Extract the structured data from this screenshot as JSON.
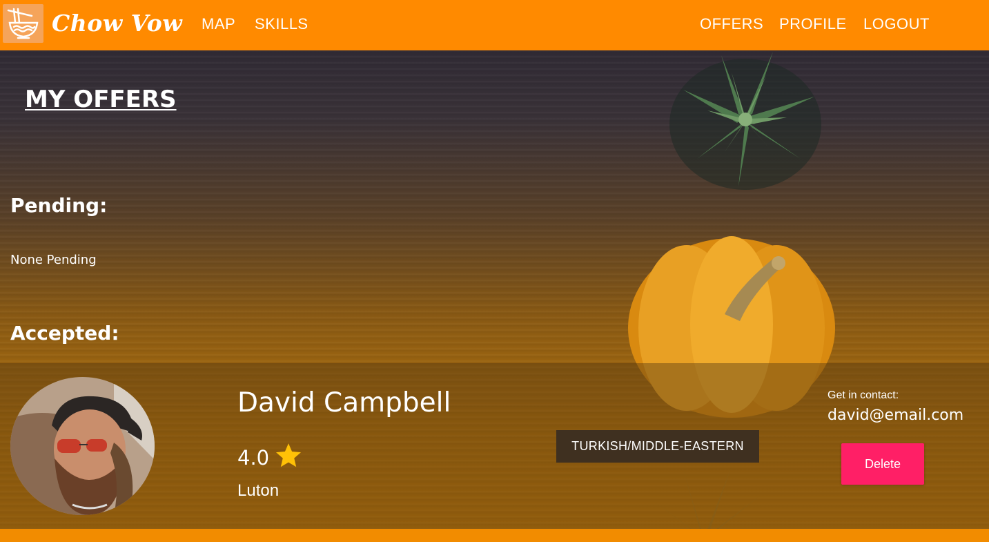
{
  "navbar": {
    "brand": "Chow Vow",
    "links_left": [
      "MAP",
      "SKILLS"
    ],
    "links_right": [
      "OFFERS",
      "PROFILE",
      "LOGOUT"
    ]
  },
  "main": {
    "title": "MY OFFERS",
    "pending_heading": "Pending:",
    "pending_empty": "None Pending",
    "accepted_heading": "Accepted:"
  },
  "offers": [
    {
      "name": "David Campbell",
      "rating": "4.0",
      "location": "Luton",
      "cuisine": "TURKISH/MIDDLE-EASTERN",
      "contact_label": "Get in contact:",
      "email": "david@email.com",
      "delete_label": "Delete"
    }
  ],
  "colors": {
    "navbar": "#ff8a00",
    "delete_button": "#ff1f66",
    "star": "#ffc107",
    "tag_bg": "#3f3020"
  },
  "icons": {
    "logo": "noodle-bowl-icon",
    "rating": "star-icon"
  }
}
